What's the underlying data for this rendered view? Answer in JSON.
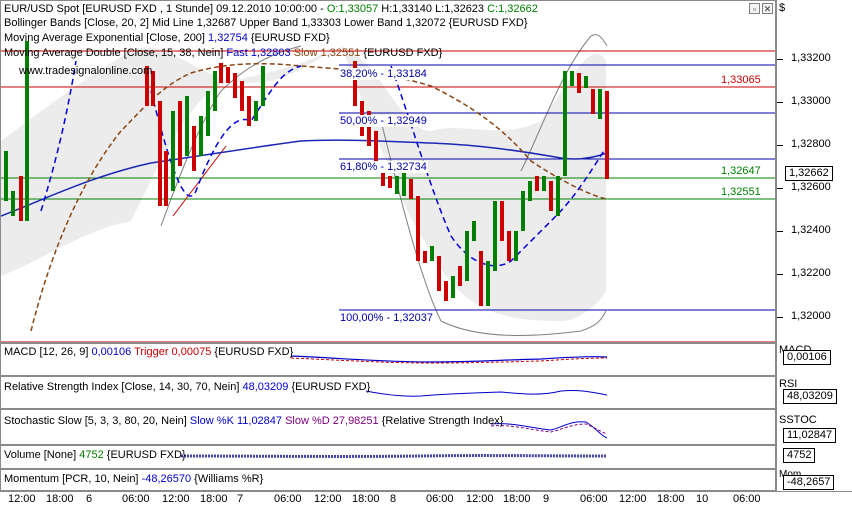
{
  "main": {
    "symbol_line": {
      "title": "EUR/USD Spot [EURUSD FXD , 1 Stunde] 09.12.2010 10:00:00 -",
      "o": "O:1,33057",
      "h": "H:1,33140",
      "l": "L:1,32623",
      "c": "C:1,32662"
    },
    "bollinger": {
      "label": "Bollinger Bands [Close, 20, 2]",
      "mid": "Mid Line 1,32687",
      "upper": "Upper Band 1,33303",
      "lower": "Lower Band 1,32072",
      "src": "{EURUSD FXD}"
    },
    "ema": {
      "label": "Moving Average Exponential [Close, 200]",
      "value": "1,32754",
      "src": "{EURUSD FXD}"
    },
    "mad": {
      "label": "Moving Average Double [Close, 15, 38, Nein]",
      "fast": "Fast 1,32803",
      "slow": "Slow 1,32551",
      "src": "{EURUSD FXD}"
    },
    "watermark": "www.tradesignalonline.com",
    "fib_labels": [
      "38,20% - 1,33184",
      "50,00% - 1,32949",
      "61,80% - 1,32734",
      "100,00% - 1,32037"
    ],
    "line_labels": {
      "red": "1,33065",
      "green1": "1,32647",
      "green2": "1,32551",
      "current": "1,32662"
    },
    "y_ticks": [
      "1,33200",
      "1,33000",
      "1,32800",
      "1,32600",
      "1,32400",
      "1,32200",
      "1,32000"
    ],
    "currency_symbol": "$"
  },
  "macd": {
    "label": "MACD [12, 26, 9]",
    "value": "0,00106",
    "trigger": "Trigger 0,00075",
    "src": "{EURUSD FXD}",
    "axis_title": "MACD",
    "axis_value": "0,00106"
  },
  "rsi": {
    "label": "Relative Strength Index [Close, 14, 30, 70, Nein]",
    "value": "48,03209",
    "src": "{EURUSD FXD}",
    "axis_title": "RSI",
    "axis_value": "48,03209"
  },
  "stoch": {
    "label": "Stochastic Slow [5, 3, 3, 80, 20, Nein]",
    "k": "Slow %K 11,02847",
    "d": "Slow %D 27,98251",
    "src": "{Relative Strength Index}",
    "axis_title": "SSTOC",
    "axis_value": "11,02847"
  },
  "volume": {
    "label": "Volume [None]",
    "value": "4752",
    "src": "{EURUSD FXD}",
    "axis_value": "4752"
  },
  "momentum": {
    "label": "Momentum [PCR, 10, Nein]",
    "value": "-48,26570",
    "src": "{Williams %R}",
    "axis_title": "Mom",
    "axis_value": "-48,2657"
  },
  "time_axis": [
    "12:00",
    "18:00",
    "6",
    "06:00",
    "12:00",
    "18:00",
    "7",
    "06:00",
    "12:00",
    "18:00",
    "8",
    "06:00",
    "12:00",
    "18:00",
    "9",
    "06:00",
    "12:00",
    "18:00",
    "10",
    "06:00"
  ],
  "colors": {
    "up": "#008000",
    "down": "#cc0000",
    "ema": "#1c28b4",
    "fast": "#0000cc",
    "slow": "#8b4513",
    "bb": "#808080"
  }
}
